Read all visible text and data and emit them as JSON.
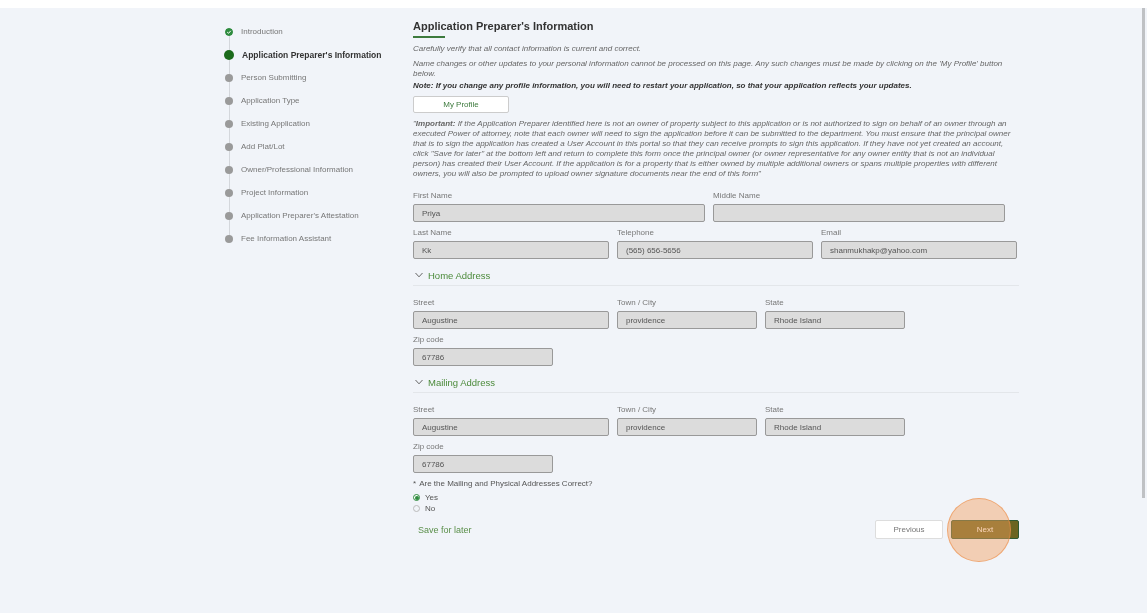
{
  "steps": [
    {
      "label": "Introduction",
      "done": true,
      "selected": false
    },
    {
      "label": "Application Preparer's Information",
      "done": false,
      "selected": true
    },
    {
      "label": "Person Submitting",
      "done": false,
      "selected": false
    },
    {
      "label": "Application Type",
      "done": false,
      "selected": false
    },
    {
      "label": "Existing Application",
      "done": false,
      "selected": false
    },
    {
      "label": "Add Plat/Lot",
      "done": false,
      "selected": false
    },
    {
      "label": "Owner/Professional Information",
      "done": false,
      "selected": false
    },
    {
      "label": "Project Information",
      "done": false,
      "selected": false
    },
    {
      "label": "Application Preparer's Attestation",
      "done": false,
      "selected": false
    },
    {
      "label": "Fee Information Assistant",
      "done": false,
      "selected": false
    }
  ],
  "title": "Application Preparer's Information",
  "verify_text": "Carefully verify that all contact information is current and correct.",
  "changes_text": "Name changes or other updates to your personal information cannot be processed on this page. Any such changes must be made by clicking on the 'My Profile' button below.",
  "note_text": "Note: If you change any profile information, you will need to restart your application, so that your application reflects your updates.",
  "profile_button": "My Profile",
  "important_text": "\"**Important:** If the Application Preparer identified here is not an owner of property subject to this application or is not authorized to sign on behalf of an owner through an executed Power of attorney, note that each owner will need to sign the application before it can be submitted to the department. You must ensure that the principal owner that is to sign the application has created a User Account in this portal so that they can receive prompts to sign this application. If they have not yet created an account, click \"Save for later\" at the bottom left and return to  complete this form once the principal owner (or owner representative for any owner entity that is not an individual person) has created their User Account. If the application is for a property that is either owned by multiple additional owners or spans multiple properties with different owners, you will also be prompted to upload owner signature documents near the end of this form\"",
  "contact_rows": [
    [
      {
        "label": "First Name",
        "value": "Priya"
      },
      {
        "label": "Middle Name"
      }
    ],
    [
      {
        "label": "Last Name",
        "value": "Kk"
      },
      {
        "label": "Telephone",
        "value": "(565) 656-5656"
      },
      {
        "label": "Email",
        "value": "shanmukhakp@yahoo.com"
      }
    ]
  ],
  "sections": [
    {
      "title": "Home Address",
      "expanded": true,
      "rows": [
        [
          {
            "label": "Street",
            "value": "Augustine"
          },
          {
            "label": "Town / City",
            "value": "providence"
          },
          {
            "label": "State",
            "value": "Rhode Island"
          }
        ],
        [
          {
            "label": "Zip code",
            "value": "67786"
          }
        ]
      ]
    },
    {
      "title": "Mailing Address",
      "expanded": true,
      "rows": [
        [
          {
            "label": "Street",
            "value": "Augustine"
          },
          {
            "label": "Town / City",
            "value": "providence"
          },
          {
            "label": "State",
            "value": "Rhode Island"
          }
        ],
        [
          {
            "label": "Zip code",
            "value": "67786"
          }
        ]
      ]
    }
  ],
  "question": {
    "required_mark": "*",
    "label": "Are the Mailing and Physical Addresses Correct?",
    "options": [
      {
        "label": "Yes",
        "selected": true
      },
      {
        "label": "No",
        "selected": false
      }
    ]
  },
  "save_link": "Save for later",
  "previous_button": "Previous",
  "next_button": "Next"
}
